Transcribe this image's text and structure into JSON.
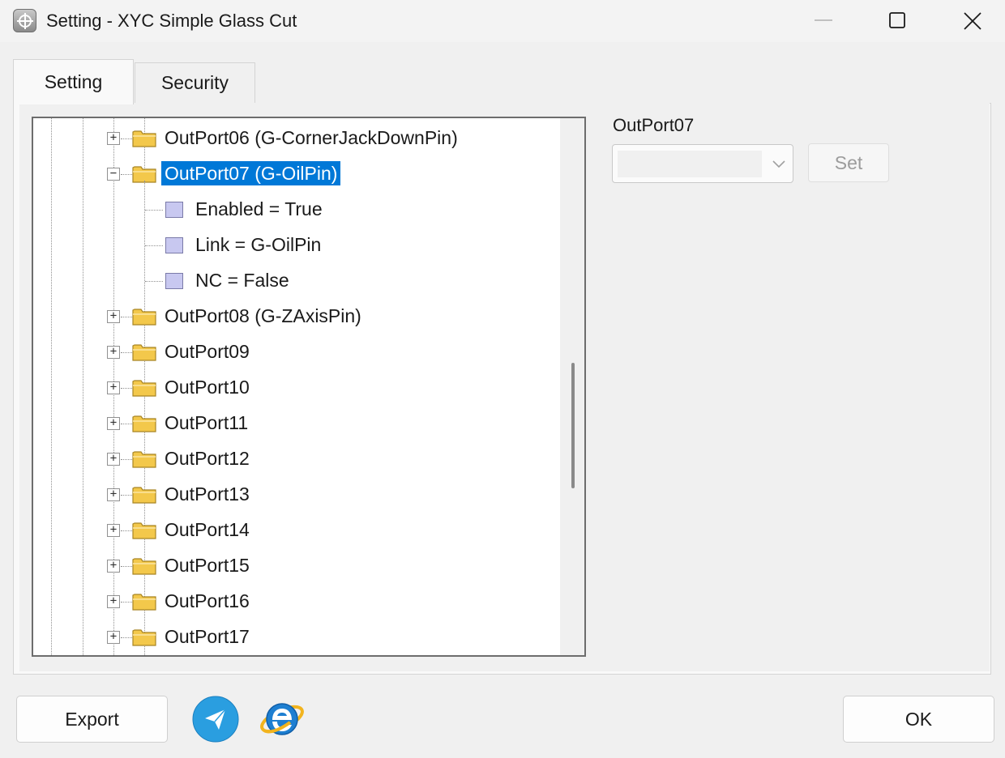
{
  "window": {
    "title": "Setting - XYC Simple Glass Cut",
    "app_icon": "crosshair-icon",
    "controls": [
      "minimize-icon",
      "maximize-icon",
      "close-icon"
    ]
  },
  "tabs": [
    {
      "label": "Setting",
      "active": true
    },
    {
      "label": "Security",
      "active": false
    }
  ],
  "tree": {
    "nodes": [
      {
        "label": "OutPort06 (G-CornerJackDownPin)",
        "type": "folder",
        "expanded": false
      },
      {
        "label": "OutPort07 (G-OilPin)",
        "type": "folder",
        "expanded": true,
        "selected": true
      },
      {
        "label": "Enabled = True",
        "type": "property"
      },
      {
        "label": "Link = G-OilPin",
        "type": "property"
      },
      {
        "label": "NC = False",
        "type": "property"
      },
      {
        "label": "OutPort08 (G-ZAxisPin)",
        "type": "folder",
        "expanded": false
      },
      {
        "label": "OutPort09",
        "type": "folder",
        "expanded": false
      },
      {
        "label": "OutPort10",
        "type": "folder",
        "expanded": false
      },
      {
        "label": "OutPort11",
        "type": "folder",
        "expanded": false
      },
      {
        "label": "OutPort12",
        "type": "folder",
        "expanded": false
      },
      {
        "label": "OutPort13",
        "type": "folder",
        "expanded": false
      },
      {
        "label": "OutPort14",
        "type": "folder",
        "expanded": false
      },
      {
        "label": "OutPort15",
        "type": "folder",
        "expanded": false
      },
      {
        "label": "OutPort16",
        "type": "folder",
        "expanded": false
      },
      {
        "label": "OutPort17",
        "type": "folder",
        "expanded": false
      }
    ],
    "expand_symbol": "+",
    "collapse_symbol": "−"
  },
  "property_editor": {
    "label": "OutPort07",
    "value": "",
    "set_label": "Set"
  },
  "bottom": {
    "export_label": "Export",
    "ok_label": "OK",
    "icons": [
      "telegram-icon",
      "internet-explorer-icon"
    ]
  },
  "colors": {
    "selection": "#0078d7",
    "folder": "#f3c84b",
    "property_square": "#c8c8f0"
  }
}
